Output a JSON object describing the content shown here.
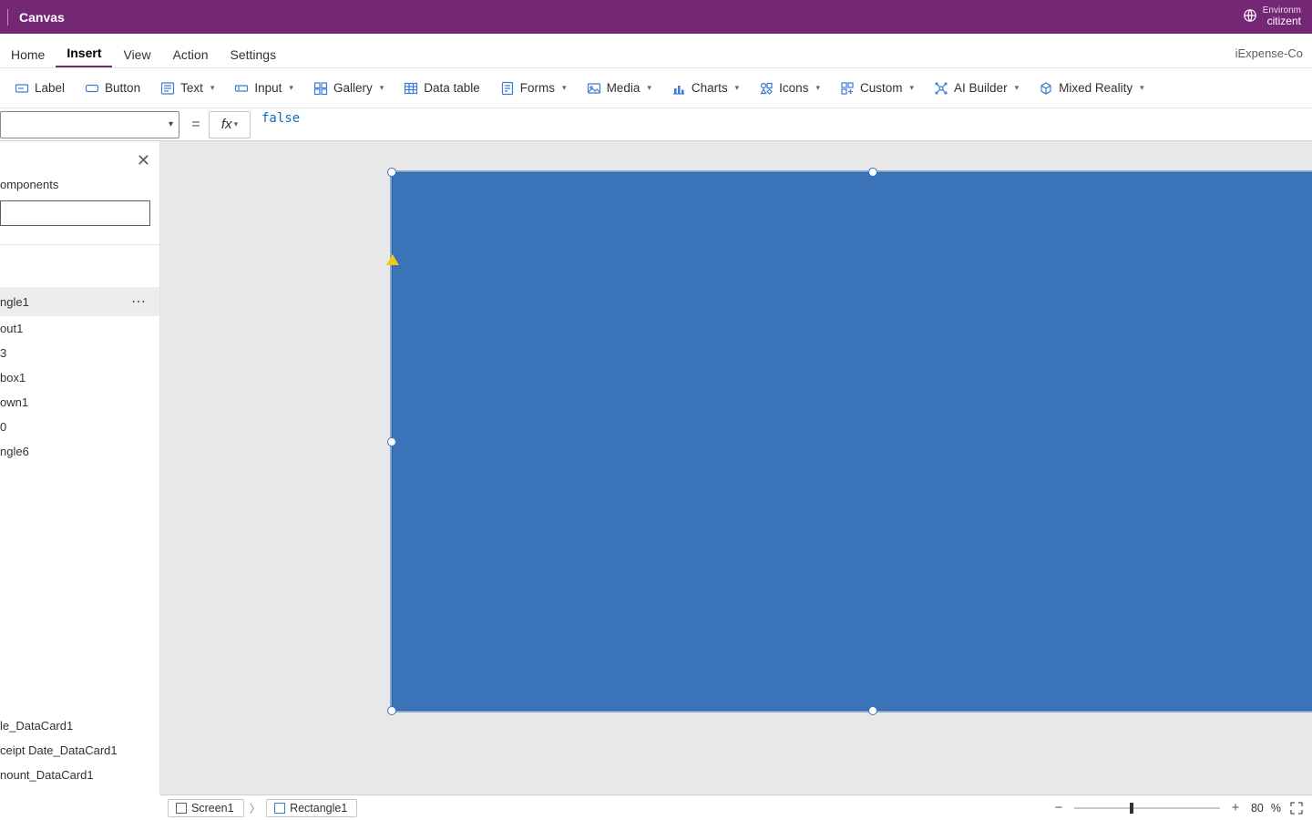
{
  "titlebar": {
    "app_title": "Canvas",
    "env_small": "Environm",
    "env_name": "citizent"
  },
  "menu": {
    "tabs": [
      "Home",
      "Insert",
      "View",
      "Action",
      "Settings"
    ],
    "active_index": 1,
    "right_label": "iExpense-Co"
  },
  "ribbon": {
    "items": [
      {
        "name": "label",
        "label": "Label",
        "has_chevron": false
      },
      {
        "name": "button",
        "label": "Button",
        "has_chevron": false
      },
      {
        "name": "text",
        "label": "Text",
        "has_chevron": true
      },
      {
        "name": "input",
        "label": "Input",
        "has_chevron": true
      },
      {
        "name": "gallery",
        "label": "Gallery",
        "has_chevron": true
      },
      {
        "name": "datatable",
        "label": "Data table",
        "has_chevron": false
      },
      {
        "name": "forms",
        "label": "Forms",
        "has_chevron": true
      },
      {
        "name": "media",
        "label": "Media",
        "has_chevron": true
      },
      {
        "name": "charts",
        "label": "Charts",
        "has_chevron": true
      },
      {
        "name": "icons",
        "label": "Icons",
        "has_chevron": true
      },
      {
        "name": "custom",
        "label": "Custom",
        "has_chevron": true
      },
      {
        "name": "aibuilder",
        "label": "AI Builder",
        "has_chevron": true
      },
      {
        "name": "mixedreality",
        "label": "Mixed Reality",
        "has_chevron": true
      }
    ]
  },
  "formula": {
    "fx_label": "fx",
    "equals": "=",
    "value": "false"
  },
  "tree": {
    "tab_label": "omponents",
    "items": [
      {
        "label": "ngle1",
        "selected": true
      },
      {
        "label": "out1",
        "selected": false
      },
      {
        "label": "3",
        "selected": false
      },
      {
        "label": "box1",
        "selected": false
      },
      {
        "label": "own1",
        "selected": false
      },
      {
        "label": "0",
        "selected": false
      },
      {
        "label": "ngle6",
        "selected": false
      }
    ],
    "bottom_items": [
      {
        "label": "le_DataCard1"
      },
      {
        "label": "ceipt Date_DataCard1"
      },
      {
        "label": "nount_DataCard1"
      }
    ]
  },
  "status": {
    "crumb1": "Screen1",
    "crumb2": "Rectangle1",
    "zoom": "80",
    "zoom_suffix": "%"
  }
}
